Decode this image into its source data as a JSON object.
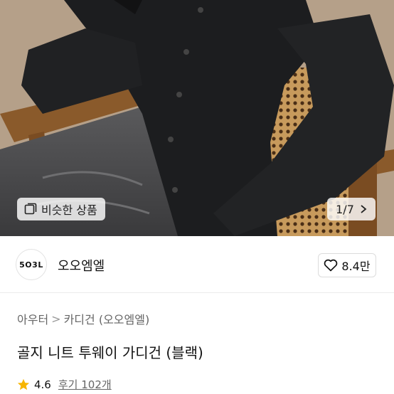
{
  "gallery": {
    "similar_label": "비슷한 상품",
    "pager": "1/7"
  },
  "shop": {
    "logo_text": "5O3L",
    "name": "오오엠엘",
    "like_count": "8.4만"
  },
  "product": {
    "breadcrumb": [
      "아우터",
      "카디건 (오오엠엘)"
    ],
    "breadcrumb_separator": ">",
    "title": "골지 니트 투웨이 가디건 (블랙)",
    "rating": "4.6",
    "review_label": "후기 102개"
  },
  "colors": {
    "star": "#f7b500",
    "border": "#dcdcdc"
  },
  "icons": {
    "similar": "image-stack-icon",
    "pager_next": "chevron-right-icon",
    "like": "heart-outline-icon",
    "rating": "star-icon"
  }
}
